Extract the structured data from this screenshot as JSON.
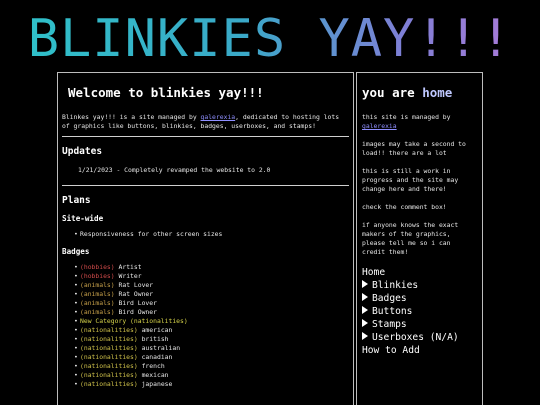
{
  "banner": {
    "title": "BLINKIES YAY!!!"
  },
  "main": {
    "welcome_title": "Welcome to blinkies yay!!!",
    "intro_before": "Blinkes yay!!! is a site managed by ",
    "intro_link": "galerexia",
    "intro_after": ", dedicated to hosting lots of graphics like buttons, blinkies, badges, userboxes, and stamps!",
    "updates_heading": "Updates",
    "update_entry": "1/21/2023 - Completely revamped the website to 2.0",
    "plans_heading": "Plans",
    "sitewide_heading": "Site-wide",
    "sitewide_items": [
      "Responsiveness for other screen sizes"
    ],
    "badges_heading": "Badges",
    "badge_items": [
      {
        "tag": "(hobbies)",
        "name": "Artist"
      },
      {
        "tag": "(hobbies)",
        "name": "Writer"
      },
      {
        "tag": "(animals)",
        "name": "Rat Lover"
      },
      {
        "tag": "(animals)",
        "name": "Rat Owner"
      },
      {
        "tag": "(animals)",
        "name": "Bird Lover"
      },
      {
        "tag": "(animals)",
        "name": "Bird Owner"
      },
      {
        "tag": "New Category (nationalities)",
        "name": ""
      },
      {
        "tag": "(nationalities)",
        "name": "american"
      },
      {
        "tag": "(nationalities)",
        "name": "british"
      },
      {
        "tag": "(nationalities)",
        "name": "australian"
      },
      {
        "tag": "(nationalities)",
        "name": "canadian"
      },
      {
        "tag": "(nationalities)",
        "name": "french"
      },
      {
        "tag": "(nationalities)",
        "name": "mexican"
      },
      {
        "tag": "(nationalities)",
        "name": "japanese"
      }
    ]
  },
  "side": {
    "title_prefix": "you are ",
    "title_home": "home",
    "managed_before": "this site is managed by ",
    "managed_link": "galerexia",
    "note_load": "images may take a second to load!! there are a lot",
    "note_wip": "this is still a work in progress and the site may change here and there!",
    "note_comment": "check the comment box!",
    "note_makers": "if anyone knows the exact makers of the graphics, please tell me so i can credit them!",
    "nav_home": "Home",
    "nav_items": [
      "Blinkies",
      "Badges",
      "Buttons",
      "Stamps",
      "Userboxes (N/A)"
    ],
    "nav_howto": "How to Add"
  },
  "colors": {
    "banner_gradient": [
      "#2ec3c9",
      "#3aa9c8",
      "#7f7fd6",
      "#b27ad8"
    ],
    "link": "#8f8fff",
    "hobbies_tag": "#d04a4a",
    "animals_tag": "#c9a24a",
    "nationalities_tag": "#d0c24a"
  }
}
